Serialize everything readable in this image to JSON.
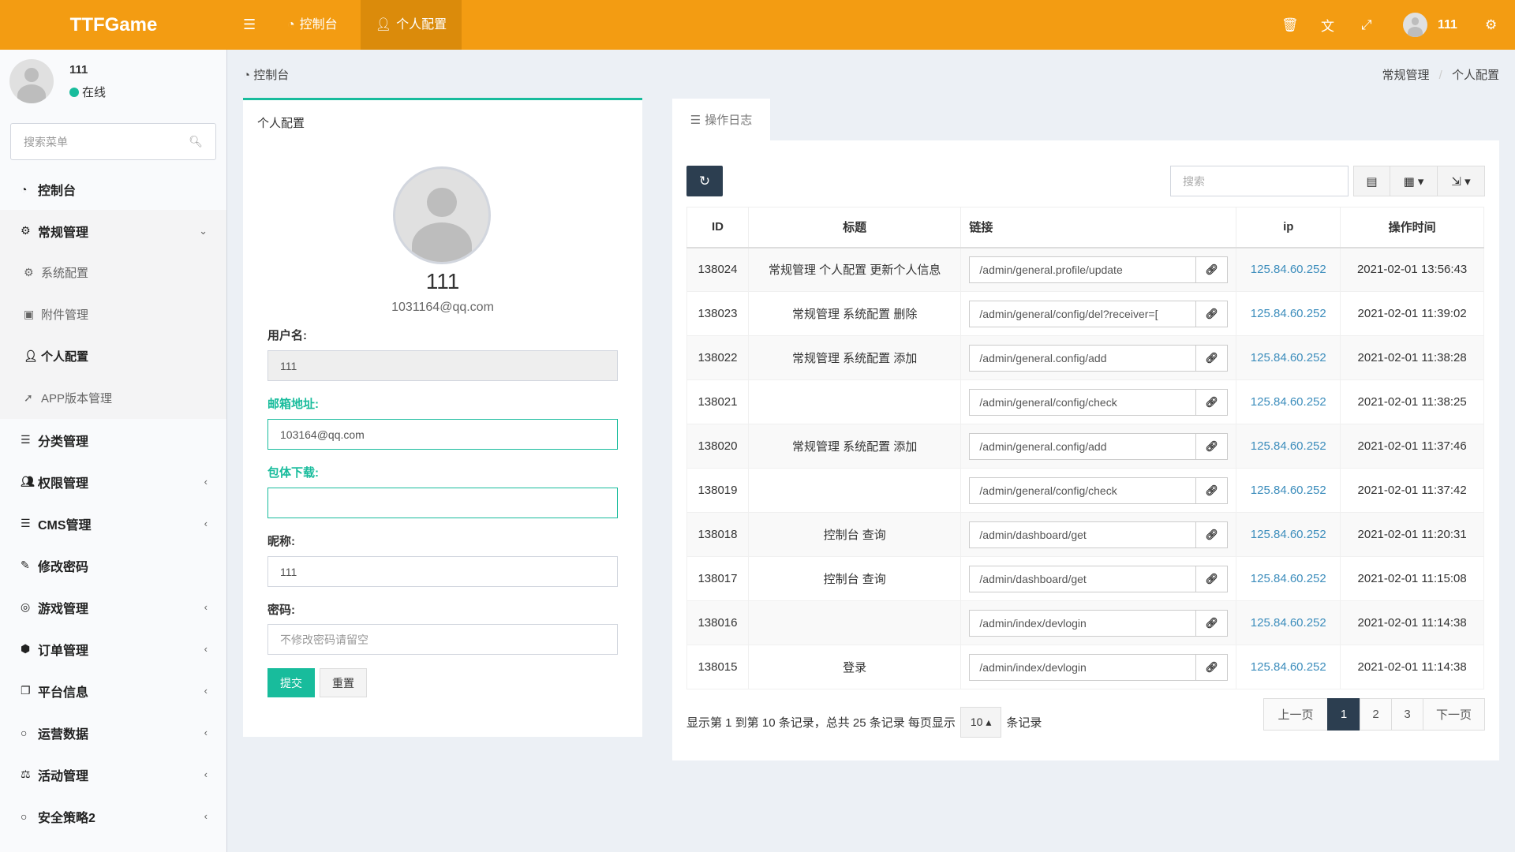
{
  "header": {
    "logo": "TTFGame",
    "tabs": [
      {
        "label": "控制台",
        "icon": "dashboard-icon"
      },
      {
        "label": "个人配置",
        "icon": "user-icon",
        "active": true
      }
    ],
    "username": "111",
    "brand_color": "#f39c12"
  },
  "sidebar": {
    "user": {
      "name": "111",
      "status": "在线"
    },
    "search_placeholder": "搜索菜单",
    "items": [
      {
        "label": "控制台",
        "icon": "dashboard-icon"
      },
      {
        "label": "常规管理",
        "icon": "cogs-icon",
        "expanded": true
      },
      {
        "label": "系统配置",
        "icon": "cog-icon",
        "sub": true
      },
      {
        "label": "附件管理",
        "icon": "file-image-icon",
        "sub": true
      },
      {
        "label": "个人配置",
        "icon": "user-icon",
        "sub": true,
        "active": true
      },
      {
        "label": "APP版本管理",
        "icon": "rocket-icon",
        "sub": true
      },
      {
        "label": "分类管理",
        "icon": "list-icon"
      },
      {
        "label": "权限管理",
        "icon": "group-icon",
        "collapsible": true
      },
      {
        "label": "CMS管理",
        "icon": "list-icon",
        "collapsible": true
      },
      {
        "label": "修改密码",
        "icon": "paint-brush-icon"
      },
      {
        "label": "游戏管理",
        "icon": "gamepad-icon",
        "collapsible": true
      },
      {
        "label": "订单管理",
        "icon": "cube-icon",
        "collapsible": true
      },
      {
        "label": "平台信息",
        "icon": "copy-icon",
        "collapsible": true
      },
      {
        "label": "运营数据",
        "icon": "circle-icon",
        "collapsible": true
      },
      {
        "label": "活动管理",
        "icon": "balance-icon",
        "collapsible": true
      },
      {
        "label": "安全策略2",
        "icon": "circle-icon",
        "collapsible": true
      }
    ]
  },
  "breadcrumb": {
    "left": "控制台",
    "items": [
      "常规管理",
      "个人配置"
    ]
  },
  "profile": {
    "title": "个人配置",
    "name": "111",
    "email": "1031164@qq.com",
    "fields": [
      {
        "label": "用户名:",
        "value": "111"
      },
      {
        "label": "邮箱地址:",
        "value": "103164@qq.com"
      },
      {
        "label": "包体下载:",
        "value": ""
      },
      {
        "label": "昵称:",
        "value": "111"
      },
      {
        "label": "密码:",
        "placeholder": "不修改密码请留空"
      }
    ],
    "submit": "提交",
    "reset": "重置"
  },
  "log": {
    "tab": "操作日志",
    "search_placeholder": "搜索",
    "columns": [
      "ID",
      "标题",
      "链接",
      "ip",
      "操作时间"
    ],
    "rows": [
      {
        "id": "138024",
        "title": "常规管理 个人配置 更新个人信息",
        "url": "/admin/general.profile/update",
        "ip": "125.84.60.252",
        "time": "2021-02-01 13:56:43"
      },
      {
        "id": "138023",
        "title": "常规管理 系统配置 删除",
        "url": "/admin/general/config/del?receiver=[",
        "ip": "125.84.60.252",
        "time": "2021-02-01 11:39:02"
      },
      {
        "id": "138022",
        "title": "常规管理 系统配置 添加",
        "url": "/admin/general.config/add",
        "ip": "125.84.60.252",
        "time": "2021-02-01 11:38:28"
      },
      {
        "id": "138021",
        "title": "",
        "url": "/admin/general/config/check",
        "ip": "125.84.60.252",
        "time": "2021-02-01 11:38:25"
      },
      {
        "id": "138020",
        "title": "常规管理 系统配置 添加",
        "url": "/admin/general.config/add",
        "ip": "125.84.60.252",
        "time": "2021-02-01 11:37:46"
      },
      {
        "id": "138019",
        "title": "",
        "url": "/admin/general/config/check",
        "ip": "125.84.60.252",
        "time": "2021-02-01 11:37:42"
      },
      {
        "id": "138018",
        "title": "控制台 查询",
        "url": "/admin/dashboard/get",
        "ip": "125.84.60.252",
        "time": "2021-02-01 11:20:31"
      },
      {
        "id": "138017",
        "title": "控制台 查询",
        "url": "/admin/dashboard/get",
        "ip": "125.84.60.252",
        "time": "2021-02-01 11:15:08"
      },
      {
        "id": "138016",
        "title": "",
        "url": "/admin/index/devlogin",
        "ip": "125.84.60.252",
        "time": "2021-02-01 11:14:38"
      },
      {
        "id": "138015",
        "title": "登录",
        "url": "/admin/index/devlogin",
        "ip": "125.84.60.252",
        "time": "2021-02-01 11:14:38"
      }
    ],
    "summary": "显示第 1 到第 10 条记录，总共 25 条记录 每页显示",
    "page_size": "10",
    "summary_suffix": "条记录",
    "pagination": {
      "prev": "上一页",
      "pages": [
        "1",
        "2",
        "3"
      ],
      "current": "1",
      "next": "下一页"
    }
  }
}
